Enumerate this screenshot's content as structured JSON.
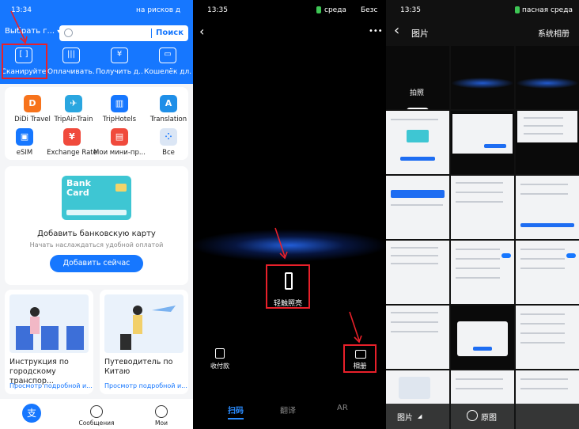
{
  "panel1": {
    "status": {
      "time": "13:34",
      "right": "на рисков д"
    },
    "location": "Выбрать г...",
    "search": {
      "placeholder": "",
      "button": "Поиск"
    },
    "quick_actions": [
      "Сканируйте",
      "Оплачивать...",
      "Получить д...",
      "Кошелёк дл..."
    ],
    "services": [
      "DiDi Travel",
      "TripAir-Train",
      "TripHotels",
      "Translation",
      "eSIM",
      "Exchange Rate",
      "Мои мини-пр...",
      "Все"
    ],
    "bank": {
      "card_text": "Bank Card",
      "title": "Добавить банковскую карту",
      "subtitle": "Начать наслаждаться удобной оплатой",
      "button": "Добавить сейчас"
    },
    "guides": [
      {
        "title": "Инструкция по городскому транспор...",
        "link": "Просмотр подробной и..."
      },
      {
        "title": "Путеводитель по Китаю",
        "link": "Просмотр подробной и..."
      }
    ],
    "tabbar": {
      "home_icon_glyph": "支",
      "messages": "Сообщения",
      "mine": "Мои"
    }
  },
  "panel2": {
    "status": {
      "time": "13:35",
      "mid": "среда",
      "right": "Безс"
    },
    "more_label": "•••",
    "flashlight": "轻触照亮",
    "pay_code": "收付款",
    "album": "相册",
    "tabs": [
      "扫码",
      "翻译",
      "AR"
    ]
  },
  "panel3": {
    "status": {
      "time": "13:35",
      "right": "пасная среда"
    },
    "title": "图片",
    "system_album": "系统相册",
    "photo_label": "拍照",
    "bottom_left": "图片",
    "bottom_right": "原图"
  },
  "colors": {
    "accent": "#1677ff",
    "highlight": "#e8202a"
  }
}
